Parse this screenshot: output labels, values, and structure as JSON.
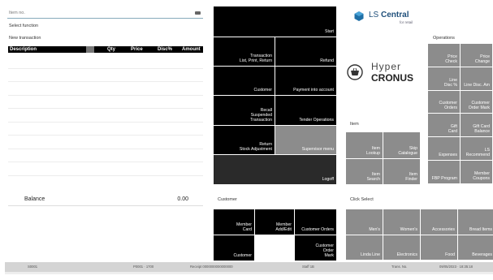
{
  "left": {
    "input_placeholder": "Item no.",
    "select_function": "Select function",
    "new_transaction": "New transaction",
    "columns": [
      "Description",
      "Qty",
      "Price",
      "Disc%",
      "Amount"
    ],
    "balance_label": "Balance",
    "balance_value": "0.00"
  },
  "middle": {
    "start": "Start",
    "transaction": "Transaction\nList, Print, Return",
    "refund": "Refund",
    "customer": "Customer",
    "payment_into_account": "Payment into account",
    "recall": "Recall\nSuspended\nTransaction",
    "tender_operations": "Tender Operations",
    "return_stock": "Return\nStock Adjustment",
    "supervisor_menu": "Supervisor menu",
    "logoff": "Logoff",
    "customer_section": "Customer",
    "member_card": "Member\nCard",
    "member_add_edit": "Member\nAdd/Edit",
    "customer_orders": "Customer Orders",
    "customer_btn": "Customer",
    "customer_order_mark": "Customer\nOrder\nMark"
  },
  "right": {
    "ls_brand": "LS ",
    "ls_brand_bold": "Central",
    "ls_sub": "for retail",
    "hyper": "Hyper",
    "cronus": "CRONUS",
    "operations": "Operations",
    "ops_buttons": [
      [
        "Price\nCheck",
        "Price\nChange"
      ],
      [
        "Line\nDisc %",
        "Line Disc. Am"
      ],
      [
        "Customer\nOrders",
        "Customer\nOrder Mark"
      ],
      [
        "Gift\nCard",
        "Gift Card\nBalance"
      ],
      [
        "Expenses",
        "LS\nRecommend"
      ],
      [
        "FBP Program",
        "Member\nCoupons"
      ]
    ],
    "item_section": "Item",
    "item_buttons": [
      [
        "Item\nLookup",
        "Skip\nCatalogue"
      ],
      [
        "Item\nSearch",
        "Item\nFinder"
      ]
    ],
    "click_select": "Click Select",
    "click_row1": [
      "Men's",
      "Women's",
      "Accessories",
      "Bread Items"
    ],
    "click_row2": [
      "Linda Line",
      "Electronics",
      "Food",
      "Beverages"
    ]
  },
  "status": {
    "store": "S0001",
    "terminal": "P0001 · 1700",
    "receipt": "Receipt 0000000000000000",
    "staff": "Staff 1B",
    "trans": "Trans. No.",
    "datetime": "09/05/2023 · 18:35:18"
  }
}
